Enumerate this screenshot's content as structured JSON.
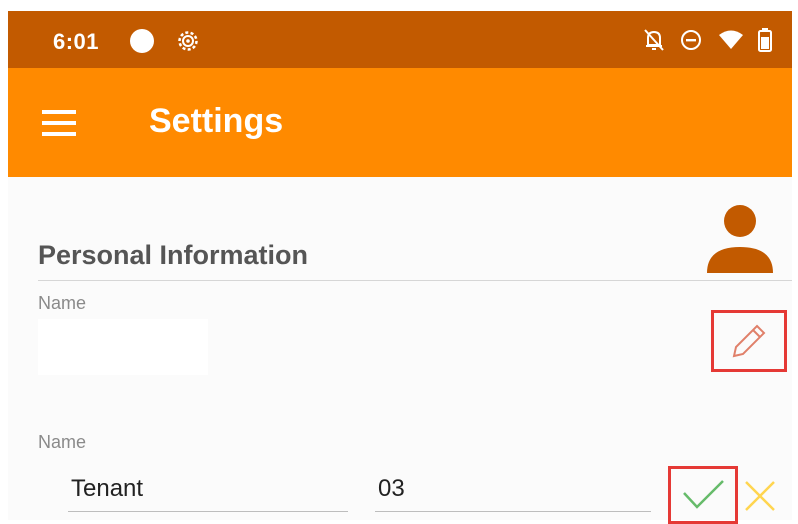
{
  "status_bar": {
    "time": "6:01",
    "icons": [
      "record-dot-icon",
      "gear-icon",
      "notifications-off-icon",
      "do-not-disturb-icon",
      "wifi-icon",
      "battery-icon"
    ]
  },
  "app_bar": {
    "title": "Settings",
    "menu_icon": "hamburger-menu-icon"
  },
  "content": {
    "section_title": "Personal Information",
    "avatar_icon": "person-icon",
    "name_display": {
      "label": "Name",
      "edit_icon": "pencil-icon"
    },
    "name_edit": {
      "label": "Name",
      "first_value": "Tenant",
      "last_value": "03",
      "confirm_icon": "check-icon",
      "cancel_icon": "close-icon"
    }
  },
  "colors": {
    "status_bar": "#c25a00",
    "app_bar": "#ff8a00",
    "accent_orange": "#c25a00",
    "highlight_red": "#e53935",
    "check_green": "#66bb6a",
    "cancel_yellow": "#ffd54f"
  }
}
